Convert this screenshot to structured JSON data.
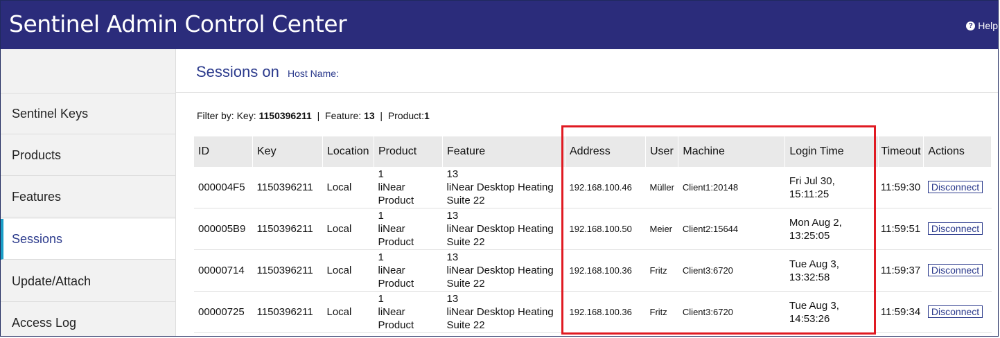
{
  "header": {
    "title_prefix": "Sentinel ",
    "title_main": "Admin Control Center",
    "help_label": "Help"
  },
  "sidebar": {
    "items": [
      {
        "label": "Sentinel Keys"
      },
      {
        "label": "Products"
      },
      {
        "label": "Features"
      },
      {
        "label": "Sessions"
      },
      {
        "label": "Update/Attach"
      },
      {
        "label": "Access Log"
      }
    ],
    "active": "Sessions"
  },
  "page": {
    "title": "Sessions on",
    "host_label": "Host Name:"
  },
  "filter": {
    "prefix": "Filter by: Key:",
    "key": "1150396211",
    "sep1": "|",
    "feature_label": "Feature:",
    "feature": "13",
    "sep2": "|",
    "product_label": "Product:",
    "product": "1"
  },
  "table": {
    "headers": [
      "ID",
      "Key",
      "Location",
      "Product",
      "Feature",
      "Address",
      "User",
      "Machine",
      "Login Time",
      "Timeout",
      "Actions"
    ],
    "rows": [
      {
        "id": "000004F5",
        "key": "1150396211",
        "location": "Local",
        "product_num": "1",
        "product_name": "liNear Product",
        "feature_num": "13",
        "feature_name": "liNear Desktop Heating Suite 22",
        "address": "192.168.100.46",
        "user": "Müller",
        "machine": "Client1:20148",
        "login_time": "Fri Jul 30, 15:11:25",
        "timeout": "11:59:30",
        "action": "Disconnect"
      },
      {
        "id": "000005B9",
        "key": "1150396211",
        "location": "Local",
        "product_num": "1",
        "product_name": "liNear Product",
        "feature_num": "13",
        "feature_name": "liNear Desktop Heating Suite 22",
        "address": "192.168.100.50",
        "user": "Meier",
        "machine": "Client2:15644",
        "login_time": "Mon Aug 2, 13:25:05",
        "timeout": "11:59:51",
        "action": "Disconnect"
      },
      {
        "id": "00000714",
        "key": "1150396211",
        "location": "Local",
        "product_num": "1",
        "product_name": "liNear Product",
        "feature_num": "13",
        "feature_name": "liNear Desktop Heating Suite 22",
        "address": "192.168.100.36",
        "user": "Fritz",
        "machine": "Client3:6720",
        "login_time": "Tue Aug 3, 13:32:58",
        "timeout": "11:59:37",
        "action": "Disconnect"
      },
      {
        "id": "00000725",
        "key": "1150396211",
        "location": "Local",
        "product_num": "1",
        "product_name": "liNear Product",
        "feature_num": "13",
        "feature_name": "liNear Desktop Heating Suite 22",
        "address": "192.168.100.36",
        "user": "Fritz",
        "machine": "Client3:6720",
        "login_time": "Tue Aug 3, 14:53:26",
        "timeout": "11:59:34",
        "action": "Disconnect"
      }
    ]
  },
  "colors": {
    "header_bg": "#2b2c7b",
    "accent": "#2b3a8c",
    "active_bar": "#1b9ec7",
    "highlight": "#e01a22"
  }
}
